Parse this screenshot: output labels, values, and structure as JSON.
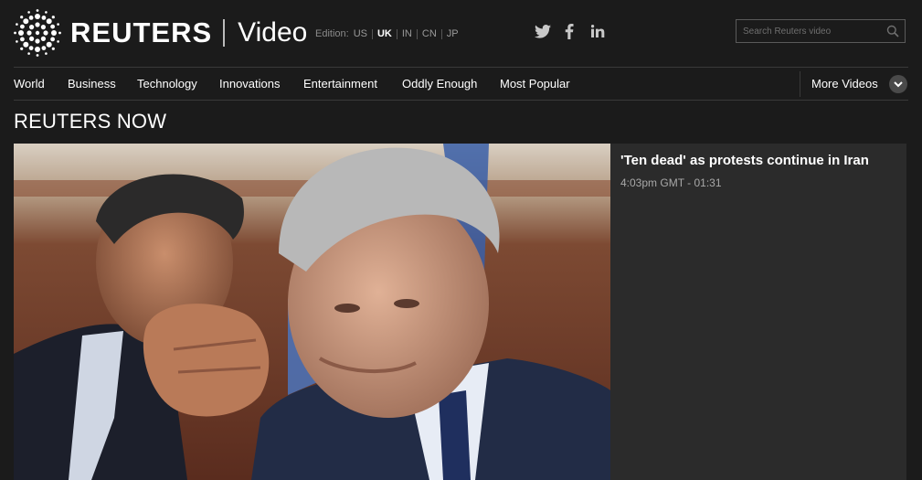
{
  "header": {
    "brand": "REUTERS",
    "section": "Video",
    "edition": {
      "label": "Edition:",
      "options": [
        "US",
        "UK",
        "IN",
        "CN",
        "JP"
      ],
      "selected": "UK"
    },
    "social": [
      {
        "name": "twitter-icon",
        "glyph": "🐦"
      },
      {
        "name": "facebook-icon",
        "glyph": "f"
      },
      {
        "name": "linkedin-icon",
        "glyph": "in"
      }
    ],
    "search": {
      "placeholder": "Search Reuters video"
    }
  },
  "nav": {
    "items": [
      "World",
      "Business",
      "Technology",
      "Innovations",
      "Entertainment",
      "Oddly Enough",
      "Most Popular"
    ],
    "more_label": "More Videos"
  },
  "section_title": "REUTERS NOW",
  "featured": {
    "title": "'Ten dead' as protests continue in Iran",
    "time": "4:03pm GMT",
    "duration": "01:31"
  },
  "colors": {
    "background": "#1b1b1b",
    "panel": "#2b2b2b",
    "text": "#ffffff",
    "muted": "#a8a8a8"
  }
}
